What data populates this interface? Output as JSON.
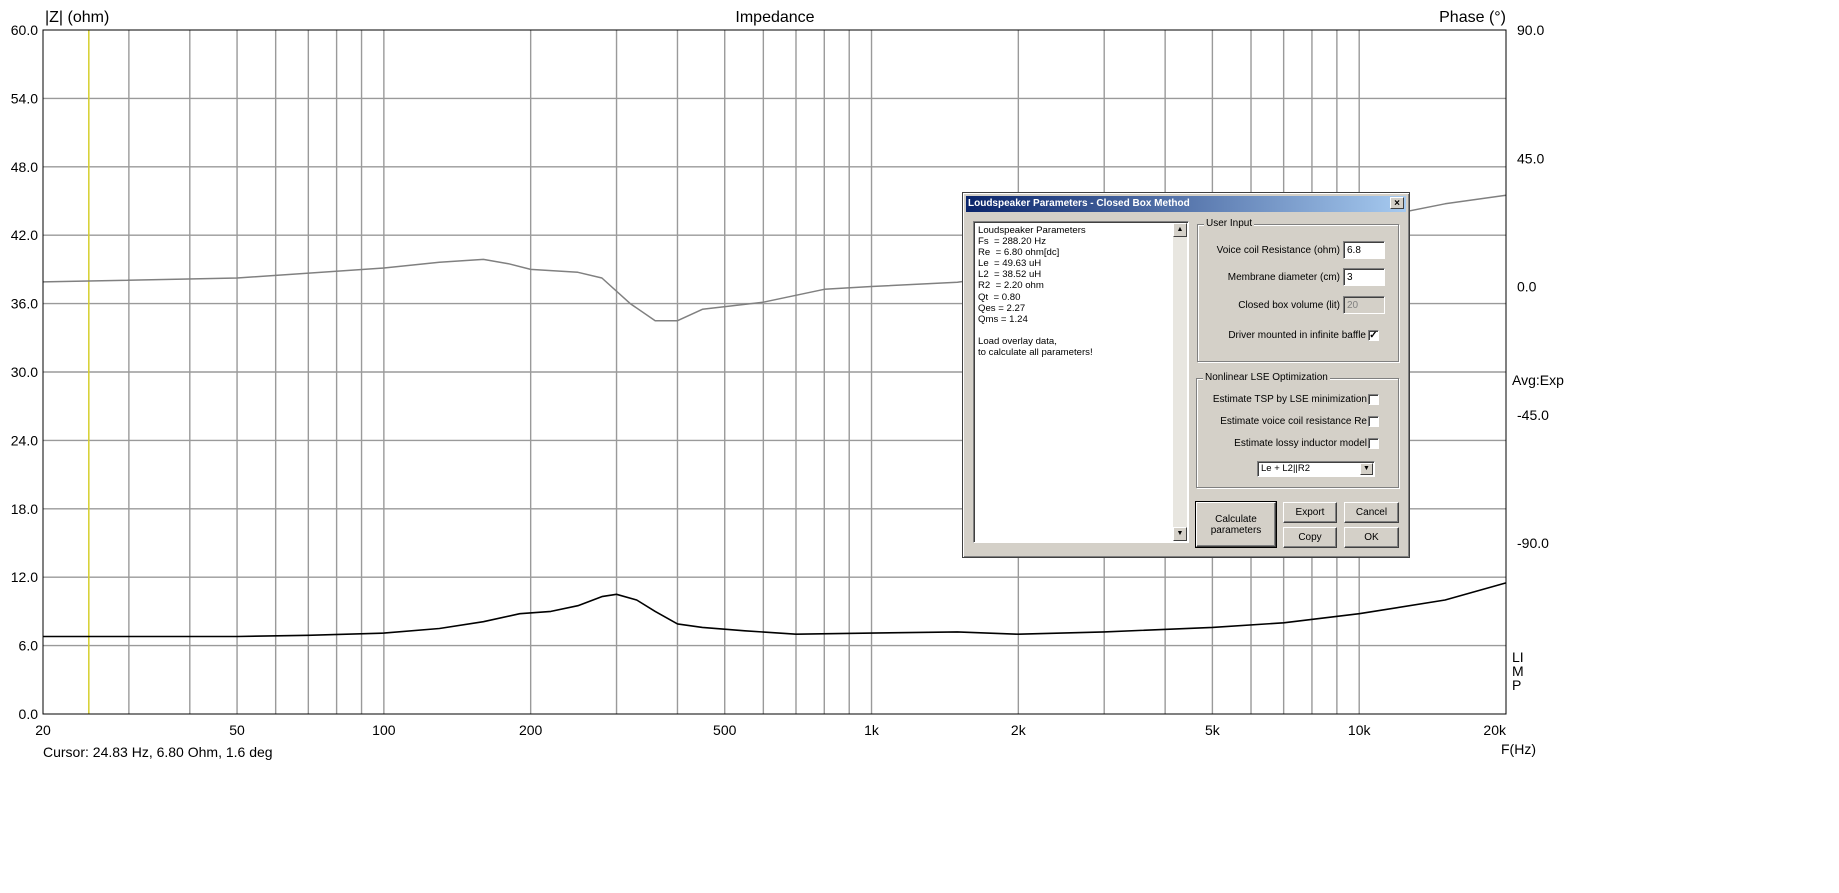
{
  "chart": {
    "title": "Impedance",
    "left_axis_label": "|Z| (ohm)",
    "right_axis_label": "Phase (°)",
    "x_axis_label": "F(Hz)",
    "cursor_readout": "Cursor: 24.83 Hz, 6.80 Ohm, 1.6 deg",
    "avg_label": "Avg:Exp",
    "imp_label": "LIMP"
  },
  "chart_data": {
    "type": "line",
    "title": "Impedance",
    "xlabel": "F(Hz)",
    "ylabel": "|Z| (ohm)",
    "y2label": "Phase (°)",
    "xscale": "log",
    "xlim": [
      20,
      20000
    ],
    "ylim": [
      0,
      60
    ],
    "y2lim": [
      -150,
      90
    ],
    "x_ticks": [
      20,
      50,
      100,
      200,
      500,
      1000,
      2000,
      5000,
      10000,
      20000
    ],
    "x_tick_labels": [
      "20",
      "50",
      "100",
      "200",
      "500",
      "1k",
      "2k",
      "5k",
      "10k",
      "20k"
    ],
    "y_ticks": [
      0,
      6,
      12,
      18,
      24,
      30,
      36,
      42,
      48,
      54,
      60
    ],
    "y_tick_labels": [
      "0.0",
      "6.0",
      "12.0",
      "18.0",
      "24.0",
      "30.0",
      "36.0",
      "42.0",
      "48.0",
      "54.0",
      "60.0"
    ],
    "y2_ticks": [
      -90,
      -45,
      0,
      45,
      90
    ],
    "y2_tick_labels": [
      "-90.0",
      "-45.0",
      "0.0",
      "45.0",
      "90.0"
    ],
    "grid": true,
    "cursor_x": 24.83,
    "series": [
      {
        "axis": "left",
        "color": "#000000",
        "points": [
          [
            20,
            6.8
          ],
          [
            30,
            6.8
          ],
          [
            50,
            6.8
          ],
          [
            70,
            6.9
          ],
          [
            100,
            7.1
          ],
          [
            130,
            7.5
          ],
          [
            160,
            8.1
          ],
          [
            190,
            8.8
          ],
          [
            220,
            9.0
          ],
          [
            250,
            9.5
          ],
          [
            280,
            10.3
          ],
          [
            300,
            10.5
          ],
          [
            330,
            10.0
          ],
          [
            360,
            9.0
          ],
          [
            400,
            7.9
          ],
          [
            450,
            7.6
          ],
          [
            550,
            7.3
          ],
          [
            700,
            7.0
          ],
          [
            1000,
            7.1
          ],
          [
            1500,
            7.2
          ],
          [
            2000,
            7.0
          ],
          [
            3000,
            7.2
          ],
          [
            5000,
            7.6
          ],
          [
            7000,
            8.0
          ],
          [
            10000,
            8.8
          ],
          [
            15000,
            10.0
          ],
          [
            20000,
            11.5
          ]
        ]
      },
      {
        "axis": "right",
        "color": "#808080",
        "points": [
          [
            20,
            1.6
          ],
          [
            50,
            3.0
          ],
          [
            100,
            6.5
          ],
          [
            130,
            8.5
          ],
          [
            160,
            9.5
          ],
          [
            180,
            8.0
          ],
          [
            200,
            6.0
          ],
          [
            250,
            5.0
          ],
          [
            280,
            3.0
          ],
          [
            320,
            -6.0
          ],
          [
            360,
            -12.0
          ],
          [
            400,
            -12.0
          ],
          [
            450,
            -8.0
          ],
          [
            600,
            -5.5
          ],
          [
            800,
            -1.0
          ],
          [
            1000,
            0.0
          ],
          [
            1500,
            1.5
          ],
          [
            2000,
            4.5
          ],
          [
            3000,
            8.0
          ],
          [
            5000,
            14.0
          ],
          [
            7000,
            19.0
          ],
          [
            10000,
            23.0
          ],
          [
            15000,
            29.0
          ],
          [
            20000,
            32.0
          ]
        ]
      }
    ]
  },
  "dialog": {
    "title": "Loudspeaker Parameters - Closed Box Method",
    "close_icon": "×",
    "results_lines": [
      "Loudspeaker Parameters",
      "Fs  = 288.20 Hz",
      "Re  = 6.80 ohm[dc]",
      "Le  = 49.63 uH",
      "L2  = 38.52 uH",
      "R2  = 2.20 ohm",
      "Qt  = 0.80",
      "Qes = 2.27",
      "Qms = 1.24",
      "",
      "Load overlay data,",
      "to calculate all parameters!"
    ],
    "user_input": {
      "title": "User Input",
      "voice_coil_label": "Voice coil Resistance (ohm)",
      "voice_coil_value": "6.8",
      "membrane_label": "Membrane diameter (cm)",
      "membrane_value": "3",
      "box_volume_label": "Closed box volume (lit)",
      "box_volume_value": "20",
      "infinite_baffle_label": "Driver mounted in infinite baffle",
      "infinite_baffle_mark": "✓"
    },
    "lse": {
      "title": "Nonlinear LSE Optimization",
      "estimate_tsp_label": "Estimate TSP by LSE minimization",
      "estimate_re_label": "Estimate voice coil resistance Re",
      "estimate_lossy_label": "Estimate lossy inductor model",
      "model_selected": "Le + L2||R2"
    },
    "buttons": {
      "calculate": "Calculate parameters",
      "export": "Export",
      "cancel": "Cancel",
      "copy": "Copy",
      "ok": "OK"
    }
  }
}
